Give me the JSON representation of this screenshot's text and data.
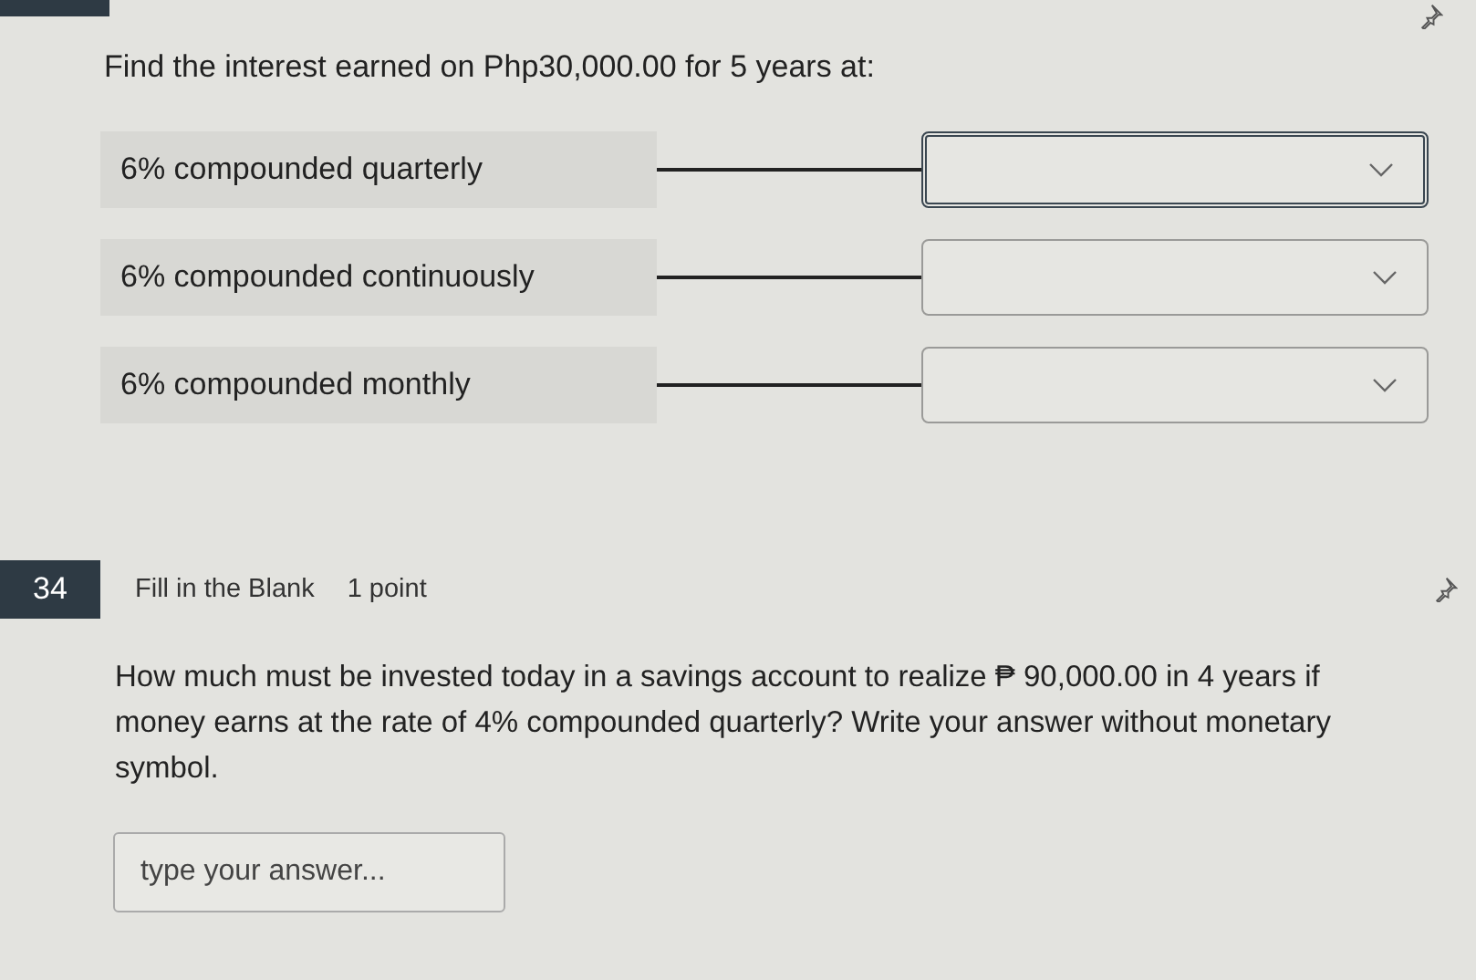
{
  "previous_question": {
    "prompt": "Find the interest earned on Php30,000.00 for 5 years at:",
    "matches": [
      {
        "label": "6% compounded quarterly",
        "focused": true
      },
      {
        "label": "6% compounded continuously",
        "focused": false
      },
      {
        "label": "6% compounded monthly",
        "focused": false
      }
    ]
  },
  "question": {
    "number": "34",
    "type": "Fill in the Blank",
    "points": "1 point",
    "prompt": "How much must be invested today in a savings account to realize ₱ 90,000.00 in 4 years if money earns at the rate of 4% compounded quarterly? Write your answer without monetary symbol.",
    "answer": {
      "placeholder": "type your answer..."
    }
  }
}
